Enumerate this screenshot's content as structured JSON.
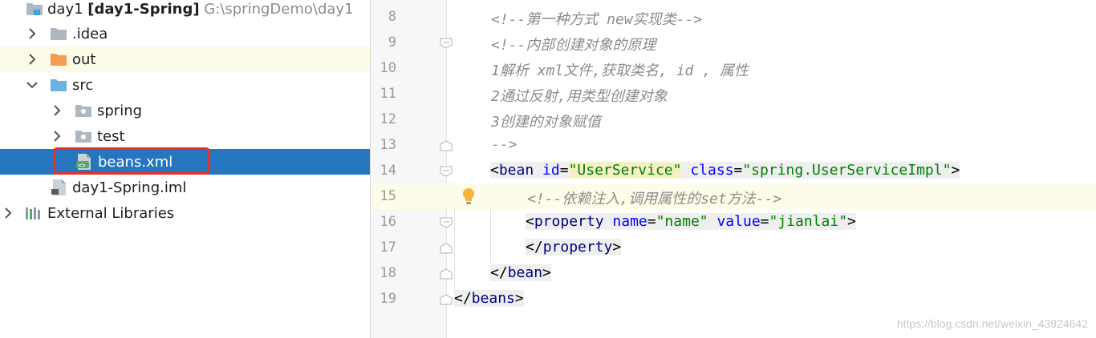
{
  "project_tree": {
    "items": [
      {
        "name": "day1",
        "module": "[day1-Spring]",
        "path": "G:\\springDemo\\day1"
      },
      {
        "name": ".idea"
      },
      {
        "name": "out"
      },
      {
        "name": "src"
      },
      {
        "name": "spring"
      },
      {
        "name": "test"
      },
      {
        "name": "beans.xml"
      },
      {
        "name": "day1-Spring.iml"
      },
      {
        "name": "External Libraries"
      }
    ]
  },
  "editor": {
    "line_numbers": [
      "8",
      "9",
      "10",
      "11",
      "12",
      "13",
      "14",
      "15",
      "16",
      "17",
      "18",
      "19"
    ],
    "l8": "<!--第一种方式 new实现类-->",
    "l9": "<!--内部创建对象的原理",
    "l10": "1解析 xml文件,获取类名, id , 属性",
    "l11": "2通过反射,用类型创建对象",
    "l12": "3创建的对象赋值",
    "l13": "-->",
    "l14": {
      "lt": "<",
      "tag": "bean",
      "a1": "id",
      "eq": "=",
      "v1": "\"UserService\"",
      "a2": "class",
      "v2": "\"spring.UserServiceImpl\"",
      "gt": ">"
    },
    "l15": "<!--依赖注入,调用属性的set方法-->",
    "l16": {
      "lt": "<",
      "tag": "property",
      "a1": "name",
      "eq": "=",
      "v1": "\"name\"",
      "a2": "value",
      "v2": "\"jianlai\"",
      "gt": ">"
    },
    "l17": {
      "lt": "</",
      "tag": "property",
      "gt": ">"
    },
    "l18": {
      "lt": "</",
      "tag": "bean",
      "gt": ">"
    },
    "l19": {
      "lt": "</",
      "tag": "beans",
      "gt": ">"
    }
  },
  "watermark": "https://blog.csdn.net/weixin_43924642",
  "colors": {
    "selection": "#2675bf",
    "highlight_box": "#e8302a",
    "current_line": "#fdfce8"
  }
}
